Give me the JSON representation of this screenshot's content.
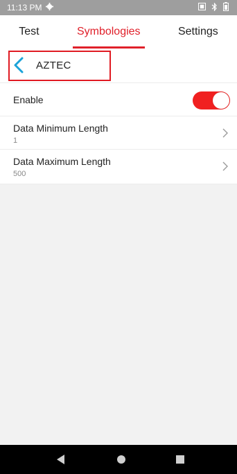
{
  "status_bar": {
    "time": "11:13 PM",
    "icons": [
      "gear-icon",
      "nfc-icon",
      "bluetooth-icon",
      "battery-icon"
    ]
  },
  "tabs": [
    {
      "label": "Test",
      "active": false
    },
    {
      "label": "Symbologies",
      "active": true
    },
    {
      "label": "Settings",
      "active": false
    }
  ],
  "header": {
    "title": "AZTEC",
    "back_icon": "chevron-left-icon"
  },
  "settings": {
    "enable": {
      "label": "Enable",
      "value": true
    },
    "data_min": {
      "label": "Data Minimum Length",
      "value": "1"
    },
    "data_max": {
      "label": "Data Maximum Length",
      "value": "500"
    }
  },
  "nav_bar": {
    "icons": [
      "back-triangle-icon",
      "home-circle-icon",
      "recents-square-icon"
    ]
  },
  "colors": {
    "accent": "#e0202a",
    "toggle_on": "#f02020",
    "back_chevron": "#1aa3d9",
    "status_bar": "#9e9e9e"
  }
}
